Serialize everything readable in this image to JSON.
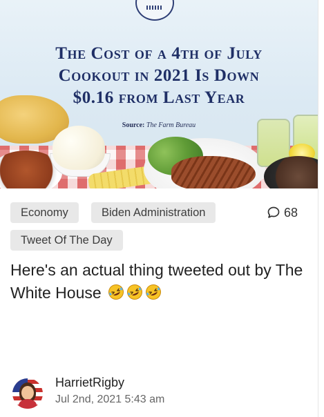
{
  "hero": {
    "title_lines": [
      "The Cost of a 4th of July",
      "Cookout in 2021 Is Down",
      "$0.16 from Last Year"
    ],
    "source_label": "Source:",
    "source_name": "The Farm Bureau"
  },
  "tags": [
    "Economy",
    "Biden Administration",
    "Tweet Of The Day"
  ],
  "comments": {
    "count": "68",
    "icon": "speech-bubble-icon"
  },
  "post": {
    "text": "Here's an actual thing tweeted out by The White House",
    "emoji": [
      "rolling-on-floor-laughing",
      "rolling-on-floor-laughing",
      "rolling-on-floor-laughing"
    ]
  },
  "author": {
    "name": "HarrietRigby",
    "date": "Jul 2nd, 2021 5:43 am"
  },
  "colors": {
    "hero_title": "#1f2f66",
    "tag_bg": "#e8e8e8",
    "text": "#222222",
    "muted": "#666666"
  }
}
